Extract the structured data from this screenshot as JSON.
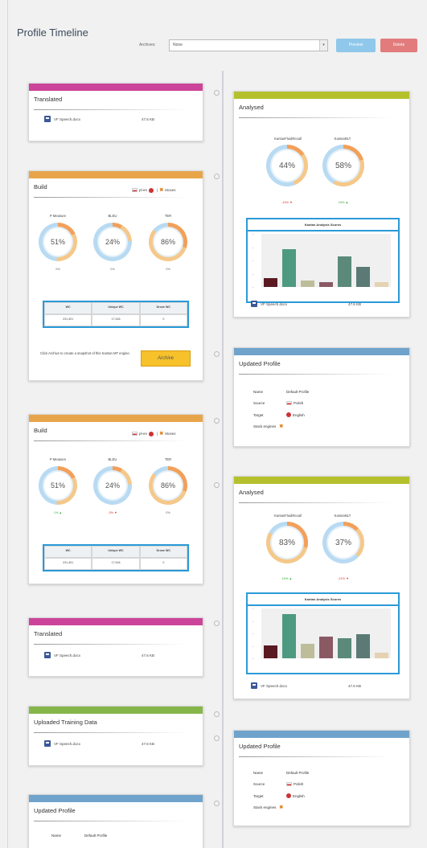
{
  "header": {
    "title": "Profile Timeline",
    "archives_label": "Archives:",
    "archives_value": "None",
    "preview_label": "Preview",
    "delete_label": "Delete"
  },
  "colors": {
    "translated": "#cc4499",
    "build": "#e8a44a",
    "analysed": "#b5c02d",
    "updated": "#6fa3cc",
    "uploaded": "#86b64a",
    "table_border": "#2a9ad8",
    "archive_button": "#f6c12a"
  },
  "left_cards": [
    {
      "type": "translated",
      "title": "Translated",
      "file": "VF Speech.docx",
      "size": "47.6 KB"
    },
    {
      "type": "build",
      "title": "Build",
      "flags": "pl-en",
      "moses": "Moses",
      "gauges": [
        {
          "label": "P Measure",
          "value": "51%",
          "percent": 51,
          "delta": "0%"
        },
        {
          "label": "BLEU",
          "value": "24%",
          "percent": 24,
          "delta": "0%"
        },
        {
          "label": "TER",
          "value": "86%",
          "percent": 86,
          "delta": "0%"
        }
      ],
      "table": {
        "headers": [
          "WC",
          "Unique WC",
          "Drone WC"
        ],
        "row": [
          "231,401",
          "17,518",
          "0"
        ]
      },
      "archive_note": "Click Archive to create a snapshot of this Kantan MT engine.",
      "archive_label": "Archive"
    },
    {
      "type": "build",
      "title": "Build",
      "flags": "pl-en",
      "moses": "Moses",
      "gauges": [
        {
          "label": "P Measure",
          "value": "51%",
          "percent": 51,
          "delta": "1%"
        },
        {
          "label": "BLEU",
          "value": "24%",
          "percent": 24,
          "delta": "-3%"
        },
        {
          "label": "TER",
          "value": "86%",
          "percent": 86,
          "delta": "0%"
        }
      ],
      "table": {
        "headers": [
          "WC",
          "Unique WC",
          "Drone WC"
        ],
        "row": [
          "231,401",
          "17,518",
          "0"
        ]
      }
    },
    {
      "type": "translated",
      "title": "Translated",
      "file": "VF Speech.docx",
      "size": "47.6 KB"
    },
    {
      "type": "uploaded",
      "title": "Uploaded Training Data",
      "file": "VF Speech.docx",
      "size": "47.6 KB"
    },
    {
      "type": "updated",
      "title": "Updated Profile",
      "rows": [
        {
          "k": "Name",
          "v": "Default Profile"
        }
      ]
    }
  ],
  "right_cards": [
    {
      "type": "analysed",
      "title": "Analysed",
      "gauges": [
        {
          "label": "KantanFluidRecall",
          "value": "44%",
          "percent": 44,
          "delta": "-15%"
        },
        {
          "label": "KantanBLT",
          "value": "58%",
          "percent": 58,
          "delta": "15%"
        }
      ],
      "chart_title": "Kantan Analysis Scores",
      "chart_data": {
        "type": "bar",
        "values": [
          12,
          50,
          9,
          6,
          40,
          27,
          6
        ]
      },
      "file": "VF Speech.docx",
      "size": "47.6 KB"
    },
    {
      "type": "updated",
      "title": "Updated Profile",
      "rows": [
        {
          "k": "Name",
          "v": "Default Profile"
        },
        {
          "k": "Source",
          "v": "Polish"
        },
        {
          "k": "Target",
          "v": "English"
        },
        {
          "k": "Stack engines",
          "v": ""
        }
      ]
    },
    {
      "type": "analysed",
      "title": "Analysed",
      "gauges": [
        {
          "label": "KantanFluidRecall",
          "value": "83%",
          "percent": 83,
          "delta": "15%"
        },
        {
          "label": "KantanBLT",
          "value": "37%",
          "percent": 37,
          "delta": "-21%"
        }
      ],
      "chart_title": "Kantan Analysis Scores",
      "chart_data": {
        "type": "bar",
        "values": [
          18,
          62,
          20,
          30,
          28,
          34,
          8
        ]
      },
      "file": "VF Speech.docx",
      "size": "47.6 KB"
    },
    {
      "type": "updated",
      "title": "Updated Profile",
      "rows": [
        {
          "k": "Name",
          "v": "Default Profile"
        },
        {
          "k": "Source",
          "v": "Polish"
        },
        {
          "k": "Target",
          "v": "English"
        },
        {
          "k": "Stack engines",
          "v": ""
        }
      ]
    }
  ]
}
